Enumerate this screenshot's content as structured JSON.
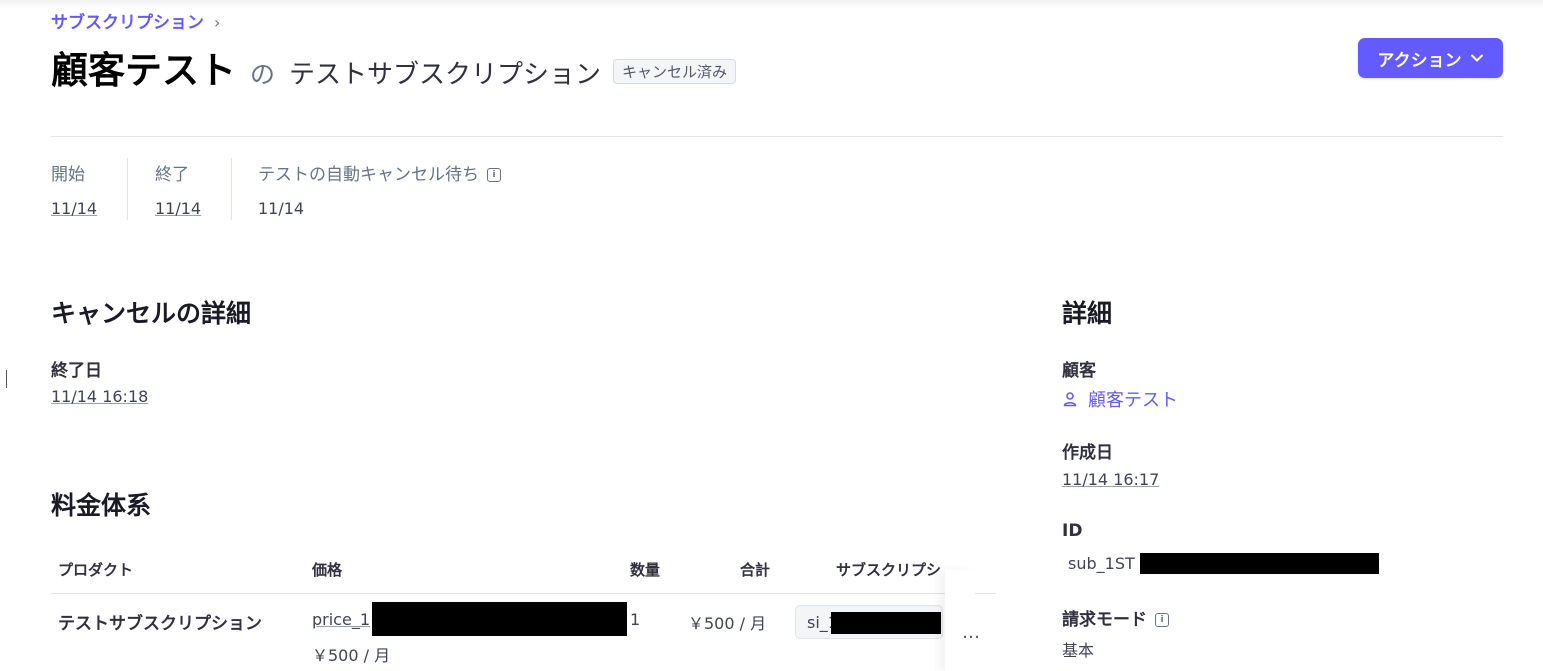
{
  "breadcrumb": {
    "label": "サブスクリプション",
    "chevron": "›"
  },
  "header": {
    "customer": "顧客テスト",
    "connector": "の",
    "subscription_name": "テストサブスクリプション",
    "status_badge": "キャンセル済み",
    "action_label": "アクション",
    "action_chevron": "⌄"
  },
  "summary": [
    {
      "label": "開始",
      "value": "11/14",
      "link": true
    },
    {
      "label": "終了",
      "value": "11/14",
      "link": true
    },
    {
      "label": "テストの自動キャンセル待ち",
      "value": "11/14",
      "link": false,
      "info_icon": true
    }
  ],
  "cancellation": {
    "heading": "キャンセルの詳細",
    "end_date_label": "終了日",
    "end_date_value": "11/14 16:18"
  },
  "pricing": {
    "heading": "料金体系",
    "columns": [
      "プロダクト",
      "価格",
      "数量",
      "合計",
      "サブスクリプシ"
    ],
    "rows": [
      {
        "product": "テストサブスクリプション",
        "price_id": "price_1",
        "price_amount": "￥500 / 月",
        "quantity": "1",
        "total": "￥500 / 月",
        "item_id": "si_1",
        "more": "…"
      }
    ]
  },
  "details": {
    "heading": "詳細",
    "customer_label": "顧客",
    "customer_value": "顧客テスト",
    "created_label": "作成日",
    "created_value": "11/14 16:17",
    "id_label": "ID",
    "id_value": "sub_1ST",
    "billing_mode_label": "請求モード",
    "billing_mode_value": "基本"
  },
  "icons": {
    "info": "info-icon",
    "user": "user-icon",
    "chevron": "chevron-down-icon",
    "more": "more-icon"
  },
  "colors": {
    "accent": "#635bff",
    "text": "#1a1b25",
    "muted": "#687385",
    "divider": "#e0e3e8"
  }
}
